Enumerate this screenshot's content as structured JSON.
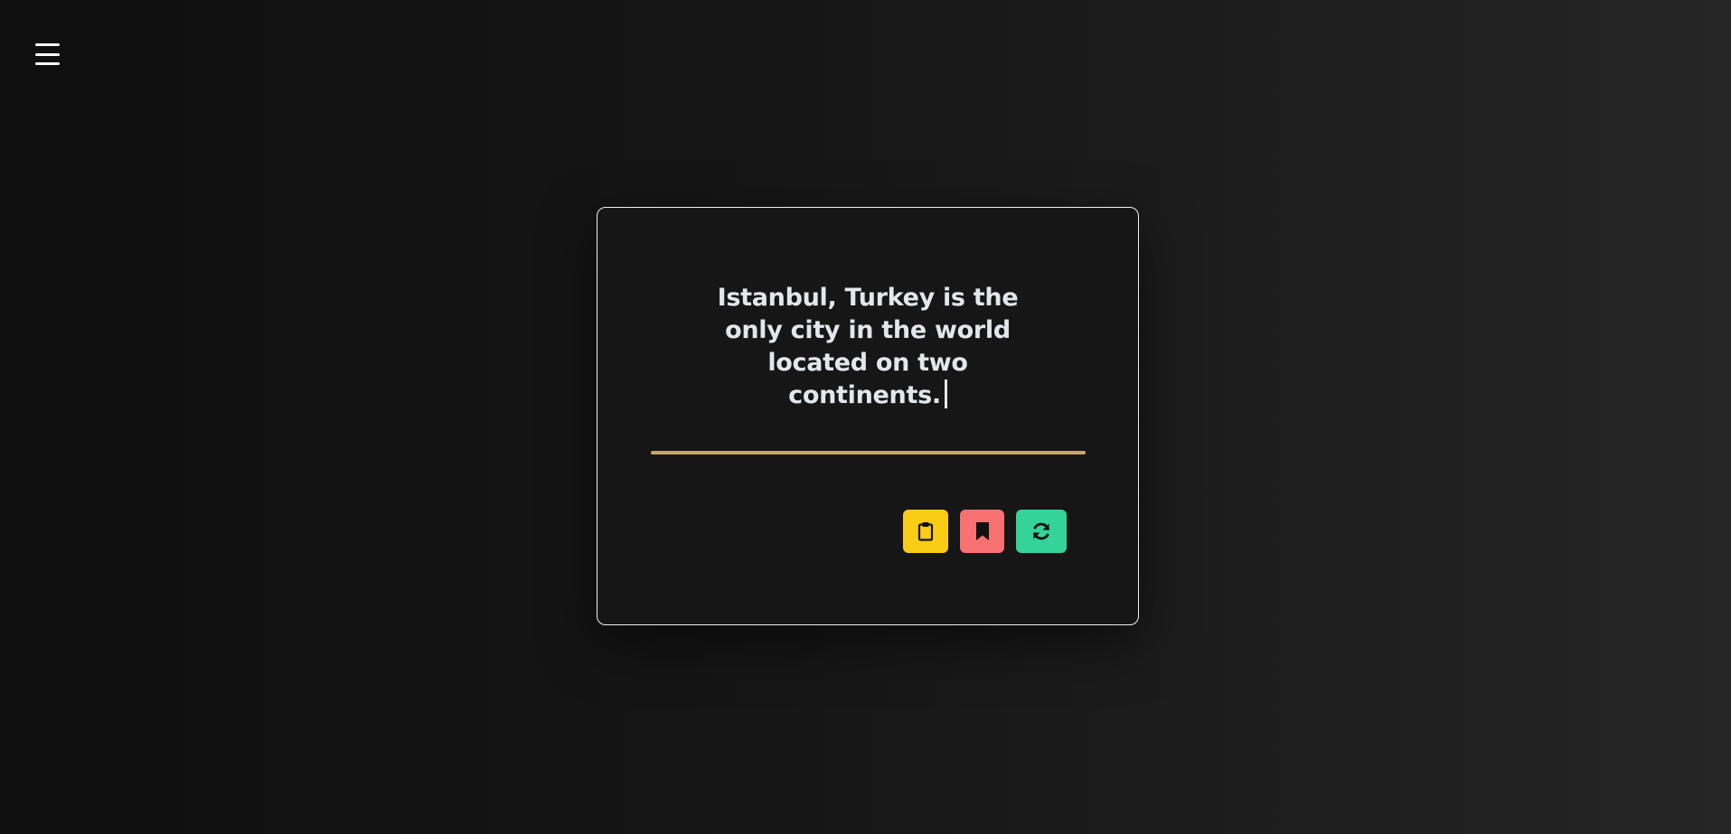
{
  "menu": {
    "icon": "hamburger-menu-icon"
  },
  "card": {
    "fact": "Istanbul, Turkey is the only city in the world located on two continents.",
    "divider_color": "#c8a95b",
    "actions": [
      {
        "name": "copy",
        "icon": "clipboard-icon",
        "color": "#facc15"
      },
      {
        "name": "bookmark",
        "icon": "bookmark-icon",
        "color": "#f87171"
      },
      {
        "name": "refresh",
        "icon": "refresh-icon",
        "color": "#34d399"
      }
    ]
  }
}
